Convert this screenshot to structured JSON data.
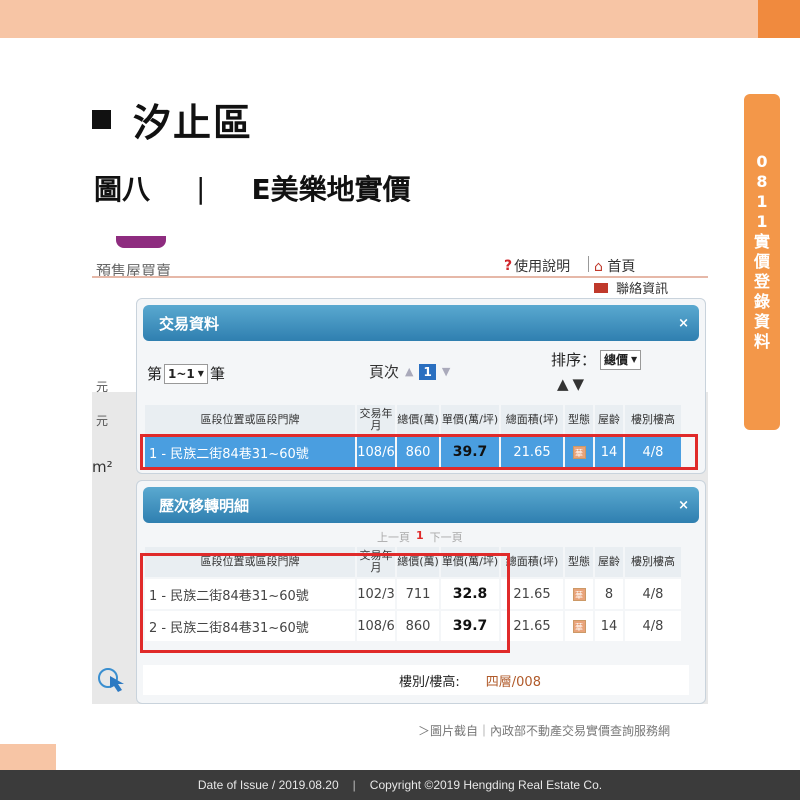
{
  "slide": {
    "section_title": "汐止區",
    "figure_label": "圖八",
    "figure_separator": "|",
    "figure_title": "E美樂地實價",
    "side_tab_chars": [
      "0",
      "8",
      "1",
      "1",
      "實",
      "價",
      "登",
      "錄",
      "資",
      "料"
    ],
    "credit": "＞圖片截自｜內政部不動產交易實價查詢服務網",
    "footer_issue": "Date of Issue / 2019.08.20",
    "footer_separator": "|",
    "footer_copyright": "Copyright ©2019 Hengding Real Estate Co.",
    "colors": {
      "accent_orange": "#f39749",
      "light_orange": "#f7c5a5",
      "footer_bg": "#3b3b3b",
      "highlight_red": "#e02a2a"
    }
  },
  "site": {
    "presale_link": "預售屋買賣",
    "help_link": "使用說明",
    "home_link": "首頁",
    "contact_link": "聯絡資訊",
    "left_labels": [
      "元",
      "元"
    ],
    "left_unit": "m²"
  },
  "transaction_panel": {
    "title": "交易資料",
    "close_icon": "×",
    "count_prefix": "第",
    "count_value": "1~1",
    "count_suffix": "筆",
    "page_label": "頁次",
    "page_current": "1",
    "sort_label": "排序：",
    "sort_value": "總價",
    "columns": [
      "區段位置或區段門牌",
      "交易年月",
      "總價(萬)",
      "單價(萬/坪)",
      "總面積(坪)",
      "型態",
      "屋齡",
      "樓別樓高"
    ],
    "rows": [
      {
        "address": "1 - 民族二街84巷31~60號",
        "date": "108/6",
        "total": "860",
        "unit": "39.7",
        "area": "21.65",
        "type": "華",
        "age": "14",
        "floor": "4/8"
      }
    ]
  },
  "history_panel": {
    "title": "歷次移轉明細",
    "close_icon": "×",
    "prev_page": "上一頁",
    "current_page": "1",
    "next_page": "下一頁",
    "columns": [
      "區段位置或區段門牌",
      "交易年月",
      "總價(萬)",
      "單價(萬/坪)",
      "總面積(坪)",
      "型態",
      "屋齡",
      "樓別樓高"
    ],
    "rows": [
      {
        "address": "1 - 民族二街84巷31~60號",
        "date": "102/3",
        "total": "711",
        "unit": "32.8",
        "area": "21.65",
        "type": "華",
        "age": "8",
        "floor": "4/8"
      },
      {
        "address": "2 - 民族二街84巷31~60號",
        "date": "108/6",
        "total": "860",
        "unit": "39.7",
        "area": "21.65",
        "type": "華",
        "age": "14",
        "floor": "4/8"
      }
    ],
    "floor_label": "樓別/樓高:",
    "floor_value": "四層/008"
  }
}
